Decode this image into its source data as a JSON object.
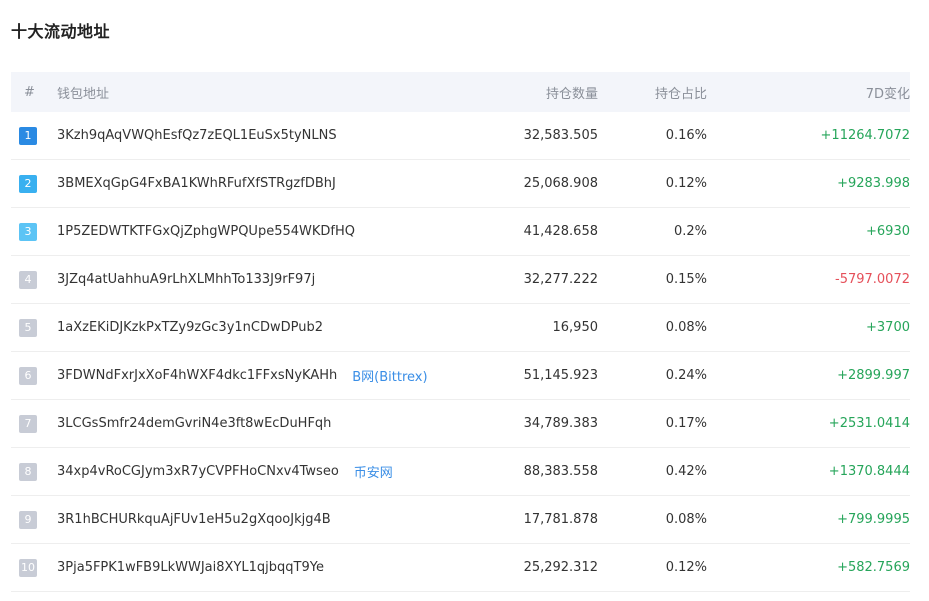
{
  "title": "十大流动地址",
  "columns": {
    "rank": "#",
    "address": "钱包地址",
    "holdings": "持仓数量",
    "percent": "持仓占比",
    "change": "7D变化"
  },
  "colors": {
    "rank1": "#2a8ae3",
    "rank2": "#39b0f0",
    "rank3": "#5cc4f5",
    "rank_other": "#c8ccd6",
    "positive": "#26a55a",
    "negative": "#e5505a",
    "link": "#3a8ee6"
  },
  "rows": [
    {
      "rank": "1",
      "address": "3Kzh9qAqVWQhEsfQz7zEQL1EuSx5tyNLNS",
      "tag": "",
      "holdings": "32,583.505",
      "percent": "0.16%",
      "change": "+11264.7072",
      "direction": "up"
    },
    {
      "rank": "2",
      "address": "3BMEXqGpG4FxBA1KWhRFufXfSTRgzfDBhJ",
      "tag": "",
      "holdings": "25,068.908",
      "percent": "0.12%",
      "change": "+9283.998",
      "direction": "up"
    },
    {
      "rank": "3",
      "address": "1P5ZEDWTKTFGxQjZphgWPQUpe554WKDfHQ",
      "tag": "",
      "holdings": "41,428.658",
      "percent": "0.2%",
      "change": "+6930",
      "direction": "up"
    },
    {
      "rank": "4",
      "address": "3JZq4atUahhuA9rLhXLMhhTo133J9rF97j",
      "tag": "",
      "holdings": "32,277.222",
      "percent": "0.15%",
      "change": "-5797.0072",
      "direction": "down"
    },
    {
      "rank": "5",
      "address": "1aXzEKiDJKzkPxTZy9zGc3y1nCDwDPub2",
      "tag": "",
      "holdings": "16,950",
      "percent": "0.08%",
      "change": "+3700",
      "direction": "up"
    },
    {
      "rank": "6",
      "address": "3FDWNdFxrJxXoF4hWXF4dkc1FFxsNyKAHh",
      "tag": "B网(Bittrex)",
      "holdings": "51,145.923",
      "percent": "0.24%",
      "change": "+2899.997",
      "direction": "up"
    },
    {
      "rank": "7",
      "address": "3LCGsSmfr24demGvriN4e3ft8wEcDuHFqh",
      "tag": "",
      "holdings": "34,789.383",
      "percent": "0.17%",
      "change": "+2531.0414",
      "direction": "up"
    },
    {
      "rank": "8",
      "address": "34xp4vRoCGJym3xR7yCVPFHoCNxv4Twseo",
      "tag": "币安网",
      "holdings": "88,383.558",
      "percent": "0.42%",
      "change": "+1370.8444",
      "direction": "up"
    },
    {
      "rank": "9",
      "address": "3R1hBCHURkquAjFUv1eH5u2gXqooJkjg4B",
      "tag": "",
      "holdings": "17,781.878",
      "percent": "0.08%",
      "change": "+799.9995",
      "direction": "up"
    },
    {
      "rank": "10",
      "address": "3Pja5FPK1wFB9LkWWJai8XYL1qjbqqT9Ye",
      "tag": "",
      "holdings": "25,292.312",
      "percent": "0.12%",
      "change": "+582.7569",
      "direction": "up"
    }
  ]
}
